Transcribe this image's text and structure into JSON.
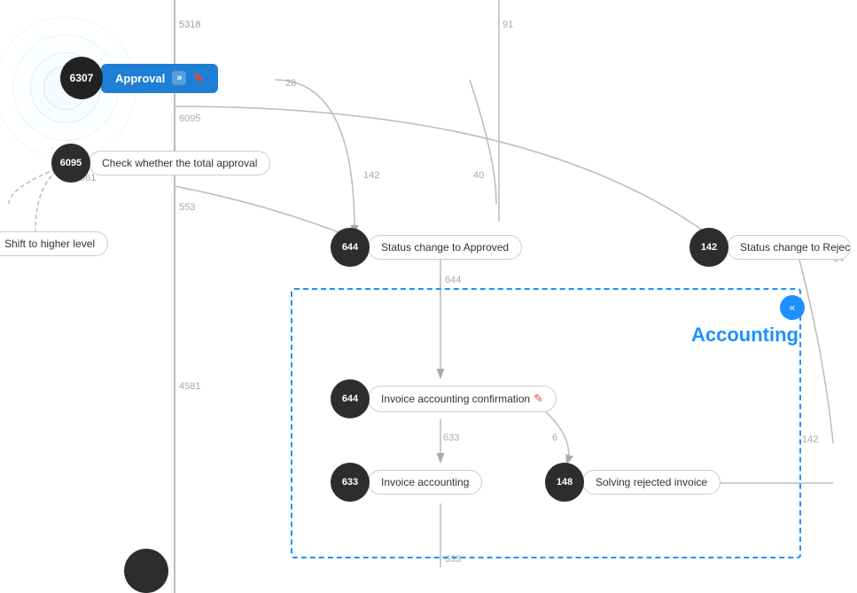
{
  "nodes": {
    "approval": {
      "id": "6307",
      "label": "Approval",
      "type": "active"
    },
    "check_approval": {
      "id": "6095",
      "label": "Check whether the total approval"
    },
    "status_approved": {
      "id": "644",
      "label": "Status change to Approved"
    },
    "status_rejected": {
      "id": "142",
      "label": "Status change to Rejected"
    },
    "invoice_confirmation": {
      "id": "644",
      "label": "Invoice accounting confirmation"
    },
    "invoice_accounting": {
      "id": "633",
      "label": "Invoice accounting"
    },
    "solving_rejected": {
      "id": "148",
      "label": "Solving rejected invoice"
    },
    "shift_higher": {
      "label": "Shift to higher level"
    }
  },
  "edge_labels": {
    "e1": "5318",
    "e2": "28",
    "e3": "6095",
    "e4": "961",
    "e5": "553",
    "e6": "142",
    "e7": "40",
    "e8": "91",
    "e9": "644",
    "e10": "4581",
    "e11": "633",
    "e12": "633",
    "e13": "6",
    "e14": "142",
    "e15": "961",
    "e16": "14"
  },
  "accounting": {
    "title": "Accounting",
    "collapse_icon": "«"
  },
  "colors": {
    "blue": "#1e7fd4",
    "accent_blue": "#1e90ff",
    "dark_node": "#2d2d2d",
    "edge": "#aaa",
    "dashed_border": "#1e90ff"
  }
}
